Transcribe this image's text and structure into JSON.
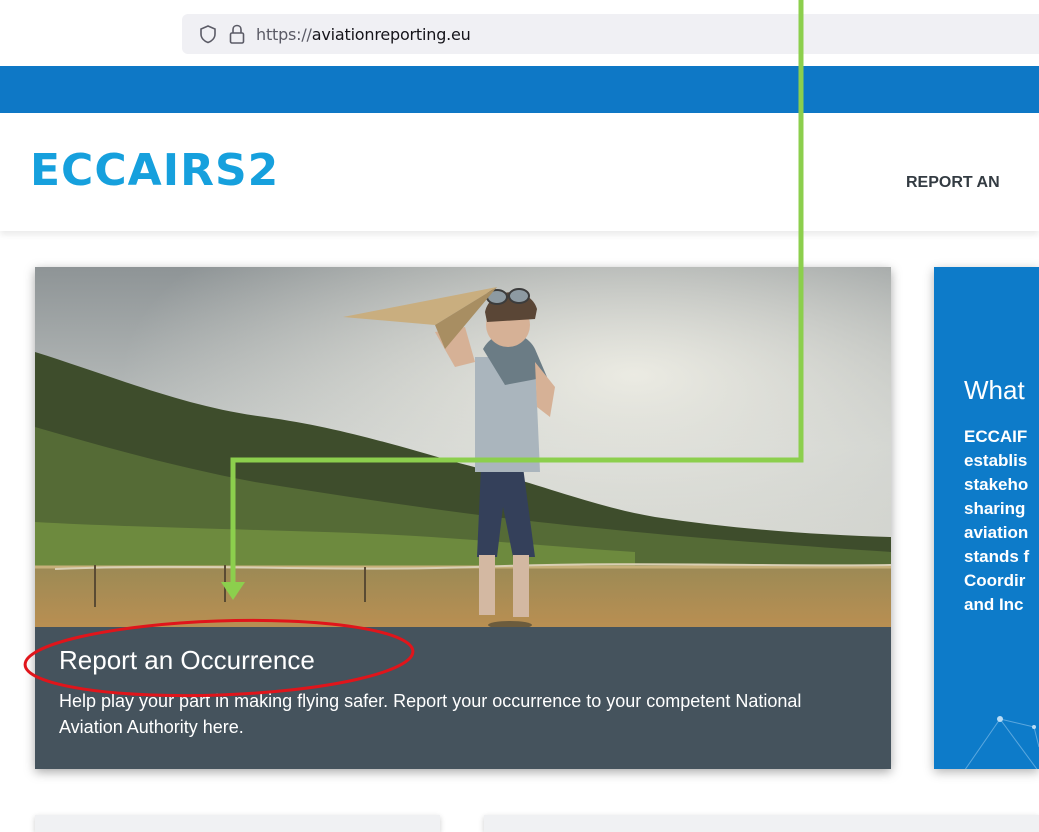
{
  "browser": {
    "url_prefix": "https://",
    "url_domain": "aviationreporting.eu"
  },
  "header": {
    "logo_text": "ECCAIRS2",
    "nav_item_label": "REPORT AN"
  },
  "hero": {
    "title": "Report an Occurrence",
    "description": "Help play your part in making flying safer. Report your occurrence to your competent National Aviation Authority here."
  },
  "info_card": {
    "title": "What",
    "lines": [
      "ECCAIF",
      "establis",
      "stakeho",
      "sharing",
      "aviation",
      "stands f",
      "Coordir",
      "and Inc"
    ]
  },
  "colors": {
    "topbar": "#0e78c6",
    "logo": "#16a0dd",
    "caption_bg": "#45535d",
    "info_bg": "#0d7bc9",
    "annotation_arrow": "#8ccf4d",
    "annotation_circle": "#e0151b"
  }
}
